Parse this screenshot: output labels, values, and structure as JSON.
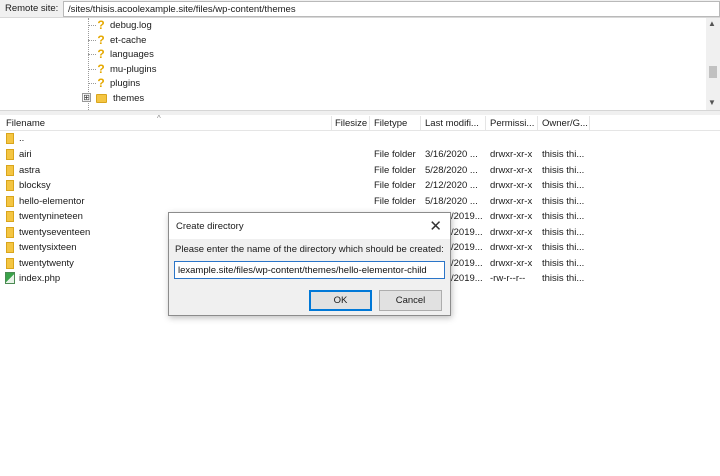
{
  "remote_site": {
    "label": "Remote site:",
    "path": "/sites/thisis.acoolexample.site/files/wp-content/themes"
  },
  "tree": {
    "items": [
      {
        "name": "debug.log",
        "icon": "question-icon"
      },
      {
        "name": "et-cache",
        "icon": "question-icon"
      },
      {
        "name": "languages",
        "icon": "question-icon"
      },
      {
        "name": "mu-plugins",
        "icon": "question-icon"
      },
      {
        "name": "plugins",
        "icon": "question-icon"
      },
      {
        "name": "themes",
        "icon": "folder-icon",
        "expander": "⊞"
      }
    ]
  },
  "columns": {
    "filename": "Filename",
    "filesize": "Filesize",
    "filetype": "Filetype",
    "last_modified": "Last modifi...",
    "permissions": "Permissi...",
    "owner": "Owner/G..."
  },
  "files": [
    {
      "name": "..",
      "type": "",
      "modified": "",
      "perms": "",
      "owner": "",
      "icon": "folder-icon"
    },
    {
      "name": "airi",
      "type": "File folder",
      "modified": "3/16/2020 ...",
      "perms": "drwxr-xr-x",
      "owner": "thisis thi...",
      "icon": "folder-icon"
    },
    {
      "name": "astra",
      "type": "File folder",
      "modified": "5/28/2020 ...",
      "perms": "drwxr-xr-x",
      "owner": "thisis thi...",
      "icon": "folder-icon"
    },
    {
      "name": "blocksy",
      "type": "File folder",
      "modified": "2/12/2020 ...",
      "perms": "drwxr-xr-x",
      "owner": "thisis thi...",
      "icon": "folder-icon"
    },
    {
      "name": "hello-elementor",
      "type": "File folder",
      "modified": "5/18/2020 ...",
      "perms": "drwxr-xr-x",
      "owner": "thisis thi...",
      "icon": "folder-icon"
    },
    {
      "name": "twentynineteen",
      "type": "",
      "modified": "/2019...",
      "perms": "drwxr-xr-x",
      "owner": "thisis thi...",
      "icon": "folder-icon"
    },
    {
      "name": "twentyseventeen",
      "type": "",
      "modified": "/2019...",
      "perms": "drwxr-xr-x",
      "owner": "thisis thi...",
      "icon": "folder-icon"
    },
    {
      "name": "twentysixteen",
      "type": "",
      "modified": "/2019...",
      "perms": "drwxr-xr-x",
      "owner": "thisis thi...",
      "icon": "folder-icon"
    },
    {
      "name": "twentytwenty",
      "type": "",
      "modified": "/2019...",
      "perms": "drwxr-xr-x",
      "owner": "thisis thi...",
      "icon": "folder-icon"
    },
    {
      "name": "index.php",
      "type": "",
      "modified": "/2019...",
      "perms": "-rw-r--r--",
      "owner": "thisis thi...",
      "icon": "php-file-icon"
    }
  ],
  "dialog": {
    "title": "Create directory",
    "message": "Please enter the name of the directory which should be created:",
    "input_value": "lexample.site/files/wp-content/themes/hello-elementor-child",
    "ok_label": "OK",
    "cancel_label": "Cancel"
  },
  "colors": {
    "folder": "#f4c542",
    "focus_border": "#2b75c8",
    "question_mark": "#e5a800"
  }
}
